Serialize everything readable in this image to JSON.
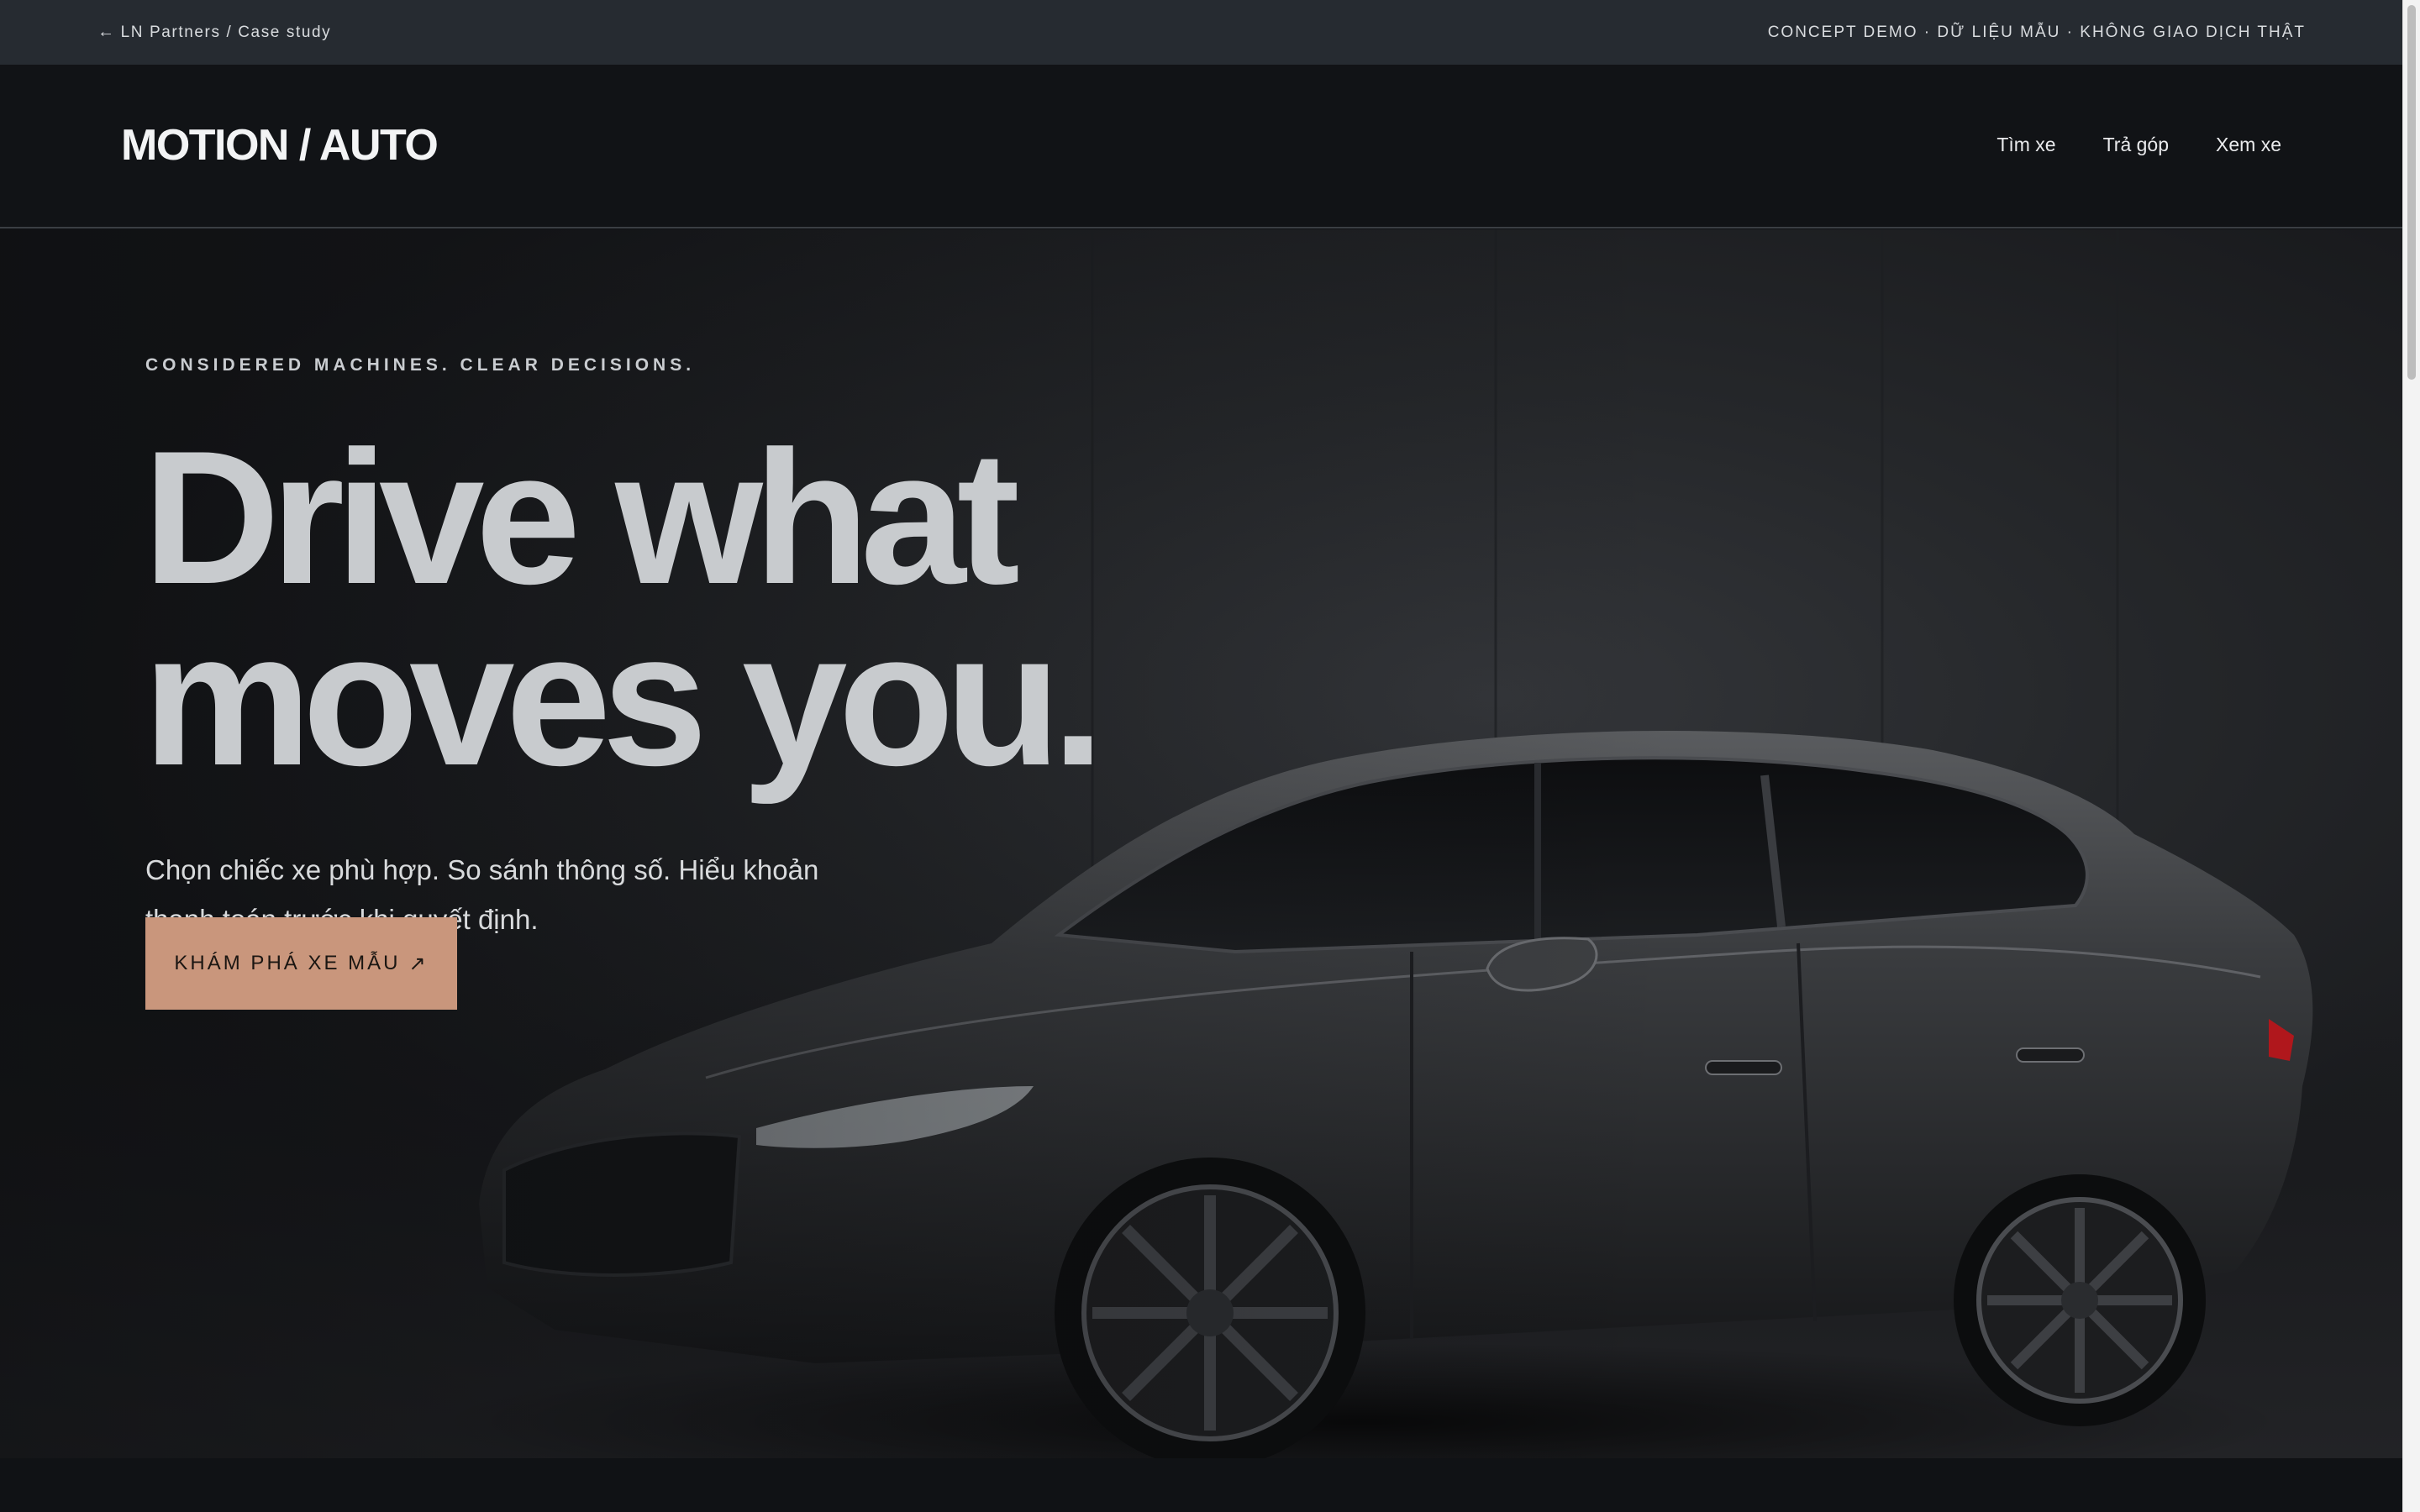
{
  "demo_bar": {
    "back_arrow": "←",
    "back_label": "LN Partners / Case study",
    "disclaimer": "CONCEPT DEMO · DỮ LIỆU MẪU · KHÔNG GIAO DỊCH THẬT"
  },
  "nav": {
    "logo": "MOTION / AUTO",
    "links": [
      "Tìm xe",
      "Trả góp",
      "Xem xe"
    ]
  },
  "hero": {
    "eyebrow": "CONSIDERED MACHINES. CLEAR DECISIONS.",
    "headline_line1": "Drive what",
    "headline_line2": "moves you.",
    "subtext": "Chọn chiếc xe phù hợp. So sánh thông số. Hiểu khoản thanh toán trước khi quyết định.",
    "cta_label": "KHÁM PHÁ XE MẪU",
    "cta_icon": "↗"
  },
  "colors": {
    "accent": "#c9967c",
    "demo_bar_bg": "#262b31",
    "nav_bg": "#111316"
  }
}
